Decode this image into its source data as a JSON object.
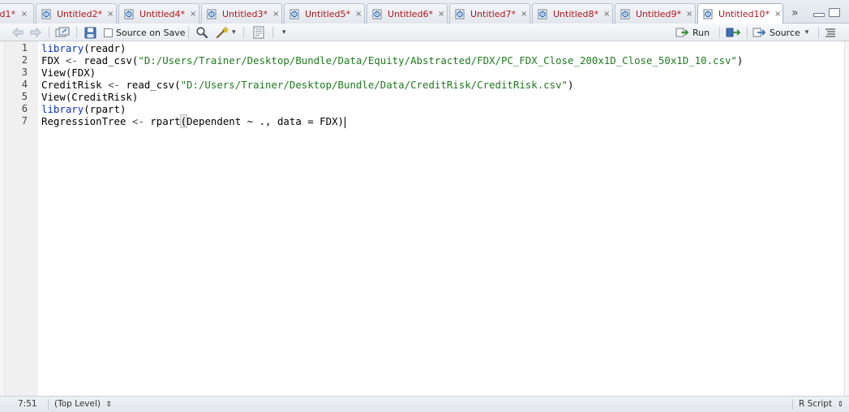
{
  "tabs": [
    {
      "label": "d1*"
    },
    {
      "label": "Untitled2*"
    },
    {
      "label": "Untitled4*"
    },
    {
      "label": "Untitled3*"
    },
    {
      "label": "Untitled5*"
    },
    {
      "label": "Untitled6*"
    },
    {
      "label": "Untitled7*"
    },
    {
      "label": "Untitled8*"
    },
    {
      "label": "Untitled9*"
    },
    {
      "label": "Untitled10*",
      "active": true
    }
  ],
  "tab_close_glyph": "×",
  "tab_overflow_glyph": "»",
  "toolbar": {
    "source_on_save_label": "Source on Save",
    "run_label": "Run",
    "source_label": "Source"
  },
  "editor": {
    "line_numbers": [
      "1",
      "2",
      "3",
      "4",
      "5",
      "6",
      "7"
    ],
    "lines": [
      "library(readr)",
      "FDX <- read_csv(\"D:/Users/Trainer/Desktop/Bundle/Data/Equity/Abstracted/FDX/PC_FDX_Close_200x1D_Close_50x1D_10.csv\")",
      "View(FDX)",
      "CreditRisk <- read_csv(\"D:/Users/Trainer/Desktop/Bundle/Data/CreditRisk/CreditRisk.csv\")",
      "View(CreditRisk)",
      "library(rpart)",
      "RegressionTree <- rpart(Dependent ~ ., data = FDX)"
    ]
  },
  "status": {
    "position": "7:51",
    "scope": "(Top Level)",
    "file_type": "R Script"
  },
  "colors": {
    "tab_text": "#b0161b",
    "keyword": "#0b30c8",
    "string": "#1f7a1f"
  },
  "icons": [
    "r-document-icon",
    "back-arrow-icon",
    "forward-arrow-icon",
    "show-in-window-icon",
    "save-icon",
    "search-icon",
    "magic-wand-icon",
    "compile-report-icon",
    "run-arrow-icon",
    "rerun-icon",
    "source-arrow-icon",
    "outline-icon",
    "tab-overflow-icon",
    "minimize-icon",
    "maximize-icon"
  ]
}
